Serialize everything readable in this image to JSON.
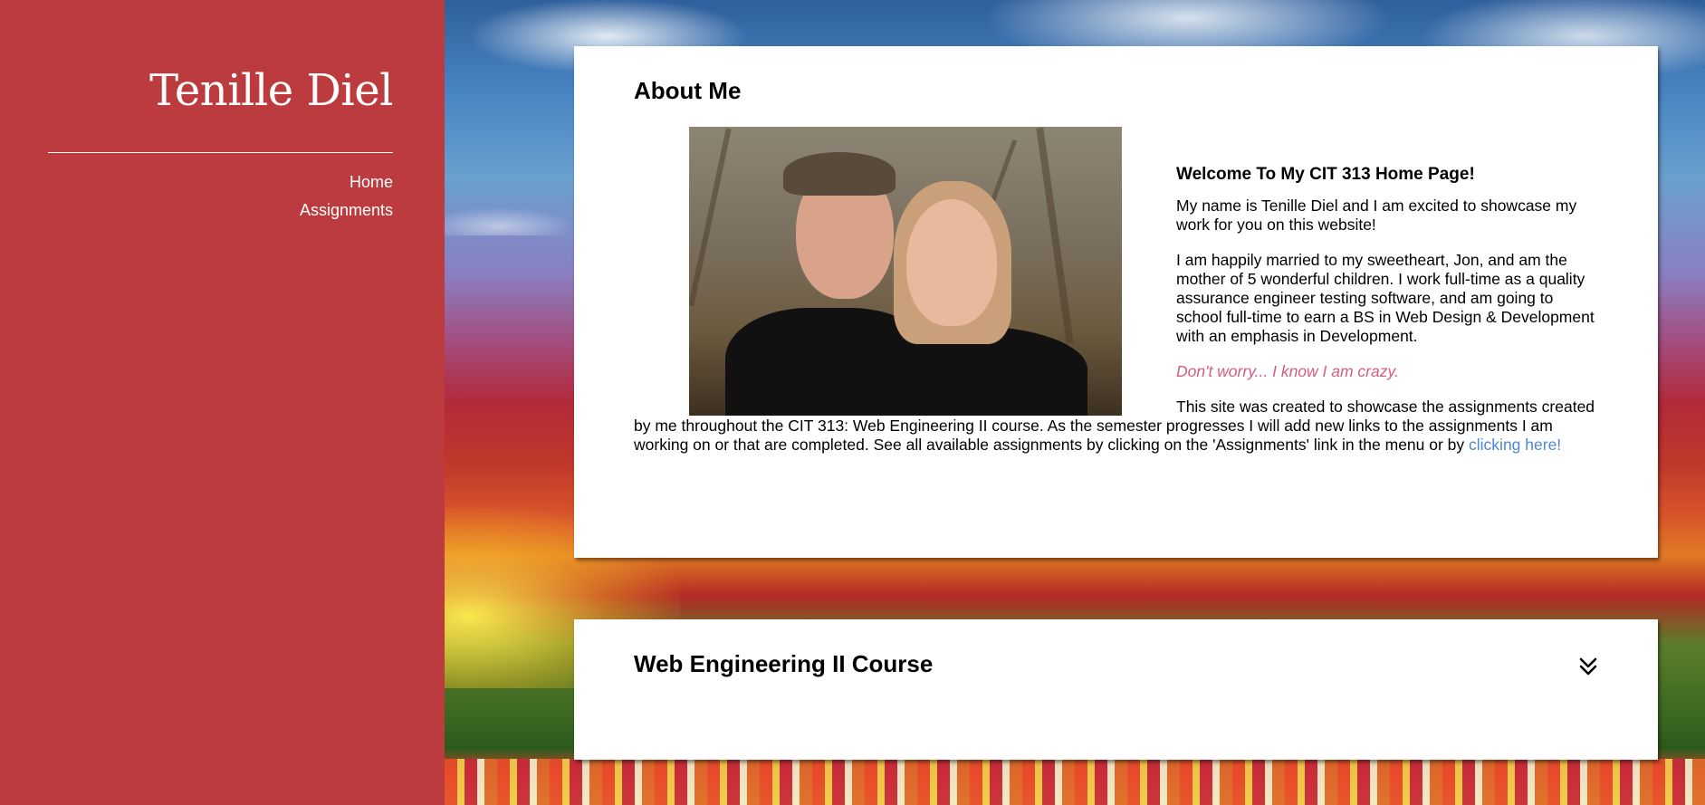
{
  "sidebar": {
    "title": "Tenille Diel",
    "nav": [
      {
        "label": "Home"
      },
      {
        "label": "Assignments"
      }
    ]
  },
  "about": {
    "heading": "About Me",
    "welcome": "Welcome To My CIT 313 Home Page!",
    "para1": "My name is Tenille Diel and I am excited to showcase my work for you on this website!",
    "para2": "I am happily married to my sweetheart, Jon, and am the mother of 5 wonderful children. I work full-time as a quality assurance engineer testing software, and am going to school full-time to earn a BS in Web Design & Development with an emphasis in Development.",
    "crazy": "Don't worry... I know I am crazy.",
    "para3": "This site was created to showcase the assignments created by me throughout the CIT 313: Web Engineering II course. As the semester progresses I will add new links to the assignments I am working on or that are completed. See all available assignments by clicking on the 'Assignments' link in the menu or by ",
    "link_label": "clicking here!"
  },
  "course": {
    "heading": "Web Engineering II Course",
    "toggle_icon": "double-chevron-down-icon"
  },
  "colors": {
    "sidebar_bg": "#bc3b3e",
    "link": "#4f86d9",
    "accent_text": "#d45c7e"
  }
}
